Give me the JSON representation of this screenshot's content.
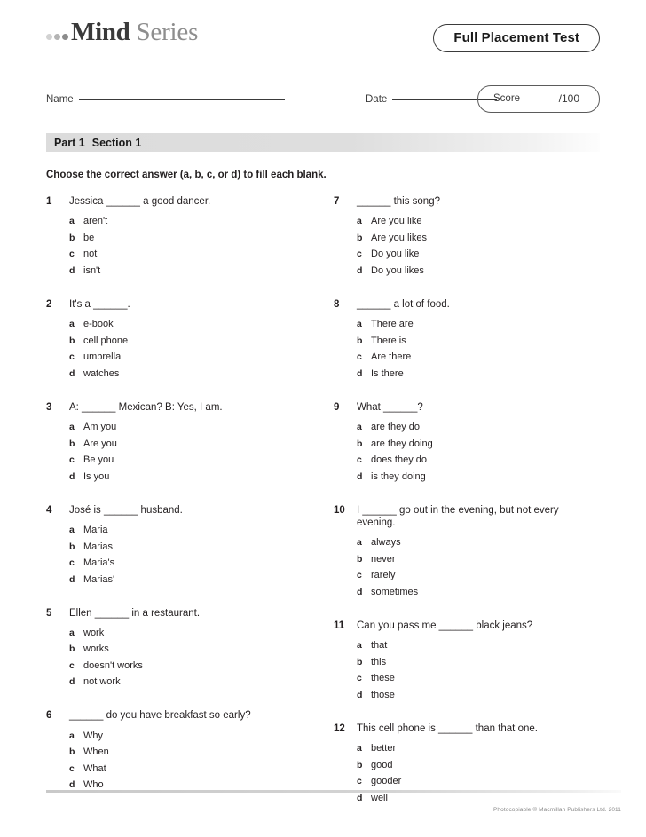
{
  "header": {
    "logo_mind": "Mind",
    "logo_series": "Series",
    "test_title": "Full Placement Test"
  },
  "fields": {
    "name_label": "Name",
    "date_label": "Date",
    "score_label": "Score",
    "score_max": "/100"
  },
  "section": {
    "part": "Part 1",
    "name": "Section 1",
    "instruction": "Choose the correct answer (a, b, c, or d) to fill each blank."
  },
  "questions_left": [
    {
      "number": "1",
      "text": "Jessica ______ a good dancer.",
      "options": [
        {
          "letter": "a",
          "text": "aren't"
        },
        {
          "letter": "b",
          "text": "be"
        },
        {
          "letter": "c",
          "text": "not"
        },
        {
          "letter": "d",
          "text": "isn't"
        }
      ]
    },
    {
      "number": "2",
      "text": "It's a ______.",
      "options": [
        {
          "letter": "a",
          "text": "e-book"
        },
        {
          "letter": "b",
          "text": "cell phone"
        },
        {
          "letter": "c",
          "text": "umbrella"
        },
        {
          "letter": "d",
          "text": "watches"
        }
      ]
    },
    {
      "number": "3",
      "text": "A: ______ Mexican? B: Yes, I am.",
      "options": [
        {
          "letter": "a",
          "text": "Am you"
        },
        {
          "letter": "b",
          "text": "Are you"
        },
        {
          "letter": "c",
          "text": "Be you"
        },
        {
          "letter": "d",
          "text": "Is you"
        }
      ]
    },
    {
      "number": "4",
      "text": "José is ______ husband.",
      "options": [
        {
          "letter": "a",
          "text": "Maria"
        },
        {
          "letter": "b",
          "text": "Marias"
        },
        {
          "letter": "c",
          "text": "Maria's"
        },
        {
          "letter": "d",
          "text": "Marias'"
        }
      ]
    },
    {
      "number": "5",
      "text": "Ellen ______ in a restaurant.",
      "options": [
        {
          "letter": "a",
          "text": "work"
        },
        {
          "letter": "b",
          "text": "works"
        },
        {
          "letter": "c",
          "text": "doesn't works"
        },
        {
          "letter": "d",
          "text": "not work"
        }
      ]
    },
    {
      "number": "6",
      "text": "______ do you have breakfast so early?",
      "options": [
        {
          "letter": "a",
          "text": "Why"
        },
        {
          "letter": "b",
          "text": "When"
        },
        {
          "letter": "c",
          "text": "What"
        },
        {
          "letter": "d",
          "text": "Who"
        }
      ]
    }
  ],
  "questions_right": [
    {
      "number": "7",
      "text": "______ this song?",
      "options": [
        {
          "letter": "a",
          "text": "Are you like"
        },
        {
          "letter": "b",
          "text": "Are you likes"
        },
        {
          "letter": "c",
          "text": "Do you like"
        },
        {
          "letter": "d",
          "text": "Do you likes"
        }
      ]
    },
    {
      "number": "8",
      "text": "______ a lot of food.",
      "options": [
        {
          "letter": "a",
          "text": "There are"
        },
        {
          "letter": "b",
          "text": "There is"
        },
        {
          "letter": "c",
          "text": "Are there"
        },
        {
          "letter": "d",
          "text": "Is there"
        }
      ]
    },
    {
      "number": "9",
      "text": "What ______?",
      "options": [
        {
          "letter": "a",
          "text": "are they do"
        },
        {
          "letter": "b",
          "text": "are they doing"
        },
        {
          "letter": "c",
          "text": "does they do"
        },
        {
          "letter": "d",
          "text": "is they doing"
        }
      ]
    },
    {
      "number": "10",
      "text": "I ______ go out in the evening, but not every evening.",
      "options": [
        {
          "letter": "a",
          "text": "always"
        },
        {
          "letter": "b",
          "text": "never"
        },
        {
          "letter": "c",
          "text": "rarely"
        },
        {
          "letter": "d",
          "text": "sometimes"
        }
      ]
    },
    {
      "number": "11",
      "text": "Can you pass me ______ black jeans?",
      "options": [
        {
          "letter": "a",
          "text": "that"
        },
        {
          "letter": "b",
          "text": "this"
        },
        {
          "letter": "c",
          "text": "these"
        },
        {
          "letter": "d",
          "text": "those"
        }
      ]
    },
    {
      "number": "12",
      "text": "This cell phone is ______ than that one.",
      "options": [
        {
          "letter": "a",
          "text": "better"
        },
        {
          "letter": "b",
          "text": "good"
        },
        {
          "letter": "c",
          "text": "gooder"
        },
        {
          "letter": "d",
          "text": "well"
        }
      ]
    }
  ],
  "footer": {
    "copyright": "Photocopiable © Macmillan Publishers Ltd. 2011"
  }
}
